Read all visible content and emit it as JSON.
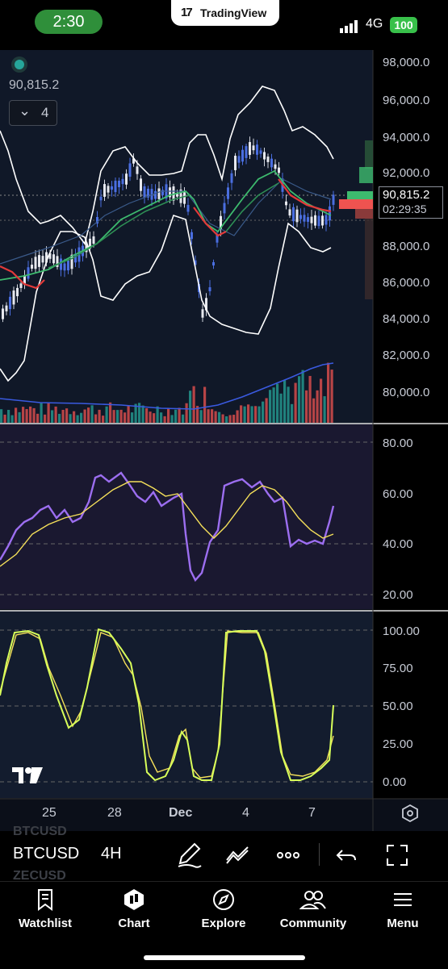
{
  "status_bar": {
    "time": "2:30",
    "app_name": "TradingView",
    "network": "4G",
    "battery": "100"
  },
  "chart": {
    "last_price": "90,815.2",
    "countdown": "02:29:35",
    "top_price": "90,815.2",
    "collapsed_indicators_count": "4",
    "price_axis": [
      "98,000.0",
      "96,000.0",
      "94,000.0",
      "92,000.0",
      "90,815.2",
      "88,000.0",
      "86,000.0",
      "84,000.0",
      "82,000.0",
      "80,000.0"
    ],
    "rsi_axis": [
      "80.00",
      "60.00",
      "40.00",
      "20.00"
    ],
    "stoch_axis": [
      "100.00",
      "75.00",
      "50.00",
      "25.00",
      "0.00"
    ],
    "date_axis": [
      "25",
      "28",
      "Dec",
      "4",
      "7"
    ],
    "colors": {
      "up": "#4a6ee0",
      "down": "#ef5350",
      "volume_up": "#26a69a",
      "volume_down": "#ef5350",
      "rsi": "#9c6ef0",
      "rsi_ma": "#f5e05a",
      "stoch_k": "#d8ff5a",
      "stoch_d": "#f5e05a",
      "bb": "#ffffff"
    }
  },
  "toolbar": {
    "symbol": "BTCUSD",
    "interval": "4H",
    "ghost_symbol_above": "BTCUSD",
    "ghost_symbol_below": "ZECUSD"
  },
  "bottom_nav": [
    {
      "label": "Watchlist",
      "icon": "bookmark-icon"
    },
    {
      "label": "Chart",
      "icon": "chart-candles-icon"
    },
    {
      "label": "Explore",
      "icon": "compass-icon"
    },
    {
      "label": "Community",
      "icon": "people-icon"
    },
    {
      "label": "Menu",
      "icon": "hamburger-icon"
    }
  ]
}
